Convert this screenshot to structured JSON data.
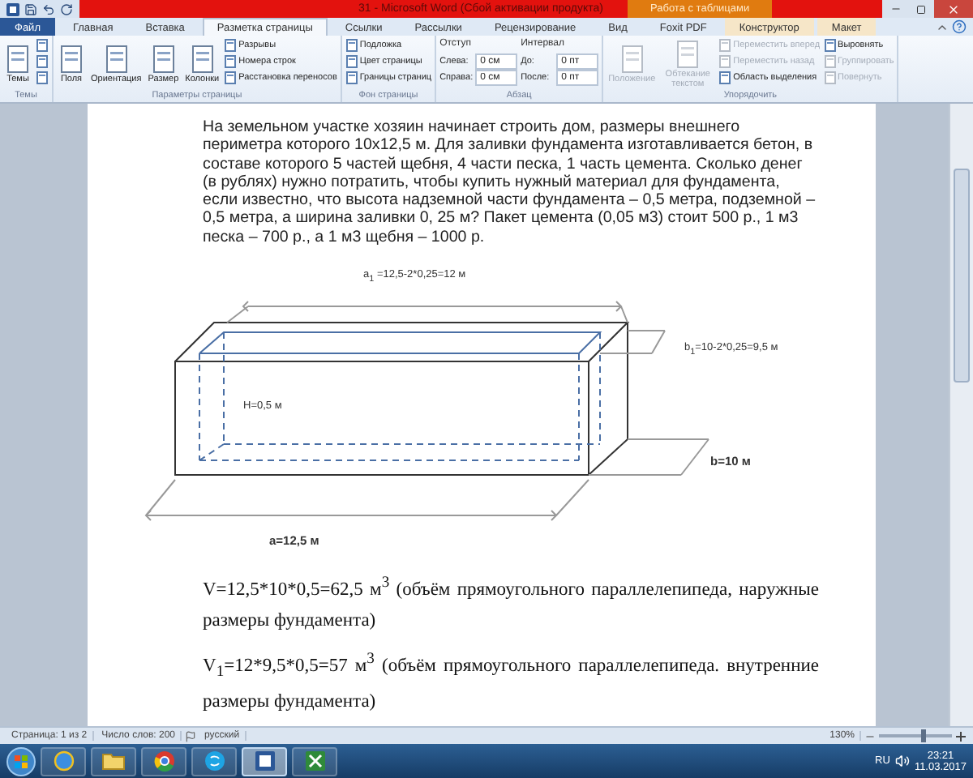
{
  "title_bar": {
    "title": "31 - Microsoft Word (Сбой активации продукта)",
    "context_tab": "Работа с таблицами"
  },
  "tabs": [
    {
      "label": "Файл",
      "kind": "file",
      "selected": false
    },
    {
      "label": "Главная",
      "kind": "normal",
      "selected": false
    },
    {
      "label": "Вставка",
      "kind": "normal",
      "selected": false
    },
    {
      "label": "Разметка страницы",
      "kind": "normal",
      "selected": true
    },
    {
      "label": "Ссылки",
      "kind": "normal",
      "selected": false
    },
    {
      "label": "Рассылки",
      "kind": "normal",
      "selected": false
    },
    {
      "label": "Рецензирование",
      "kind": "normal",
      "selected": false
    },
    {
      "label": "Вид",
      "kind": "normal",
      "selected": false
    },
    {
      "label": "Foxit PDF",
      "kind": "normal",
      "selected": false
    },
    {
      "label": "Конструктор",
      "kind": "context",
      "selected": false
    },
    {
      "label": "Макет",
      "kind": "context",
      "selected": false
    }
  ],
  "ribbon": {
    "groups": [
      {
        "label": "Темы",
        "columns": [
          [
            {
              "kind": "large",
              "label": "Темы",
              "disabled": false
            }
          ],
          [
            {
              "kind": "icon",
              "disabled": false
            },
            {
              "kind": "icon",
              "disabled": false
            },
            {
              "kind": "icon",
              "disabled": false
            }
          ]
        ]
      },
      {
        "label": "Параметры страницы",
        "columns": [
          [
            {
              "kind": "large",
              "label": "Поля",
              "disabled": false
            }
          ],
          [
            {
              "kind": "large",
              "label": "Ориентация",
              "disabled": false
            }
          ],
          [
            {
              "kind": "large",
              "label": "Размер",
              "disabled": false
            }
          ],
          [
            {
              "kind": "large",
              "label": "Колонки",
              "disabled": false
            }
          ],
          [
            {
              "kind": "small",
              "label": "Разрывы",
              "disabled": false
            },
            {
              "kind": "small",
              "label": "Номера строк",
              "disabled": false
            },
            {
              "kind": "small",
              "label": "Расстановка переносов",
              "disabled": false
            }
          ]
        ]
      },
      {
        "label": "Фон страницы",
        "columns": [
          [
            {
              "kind": "small",
              "label": "Подложка",
              "disabled": false
            },
            {
              "kind": "small",
              "label": "Цвет страницы",
              "disabled": false
            },
            {
              "kind": "small",
              "label": "Границы страниц",
              "disabled": false
            }
          ]
        ]
      },
      {
        "label": "Абзац",
        "columns": [
          [
            {
              "kind": "header",
              "label": "Отступ"
            },
            {
              "kind": "spin",
              "label": "Слева:",
              "value": "0 см"
            },
            {
              "kind": "spin",
              "label": "Справа:",
              "value": "0 см"
            }
          ],
          [
            {
              "kind": "header",
              "label": "Интервал"
            },
            {
              "kind": "spin",
              "label": "До:",
              "value": "0 пт"
            },
            {
              "kind": "spin",
              "label": "После:",
              "value": "0 пт"
            }
          ]
        ]
      },
      {
        "label": "Упорядочить",
        "columns": [
          [
            {
              "kind": "large",
              "label": "Положение",
              "disabled": true
            }
          ],
          [
            {
              "kind": "large",
              "label": "Обтекание текстом",
              "disabled": true
            }
          ],
          [
            {
              "kind": "small",
              "label": "Переместить вперед",
              "disabled": true
            },
            {
              "kind": "small",
              "label": "Переместить назад",
              "disabled": true
            },
            {
              "kind": "small",
              "label": "Область выделения",
              "disabled": false
            }
          ],
          [
            {
              "kind": "small",
              "label": "Выровнять",
              "disabled": false
            },
            {
              "kind": "small",
              "label": "Группировать",
              "disabled": true
            },
            {
              "kind": "small",
              "label": "Повернуть",
              "disabled": true
            }
          ]
        ]
      }
    ]
  },
  "document": {
    "problem": "На земельном участке хозяин начинает строить дом, размеры внешнего периметра которого 10х12,5 м. Для заливки фундамента изготавливается бетон, в составе которого 5 частей щебня, 4 части песка, 1 часть цемента. Сколько денег (в рублях) нужно потратить, чтобы купить нужный материал для фундамента, если известно, что высота надземной части фундамента – 0,5 метра, подземной – 0,5 метра, а ширина заливки 0, 25 м? Пакет цемента (0,05 м3) стоит 500 р., 1 м3 песка – 700 р., а 1 м3 щебня – 1000 р.",
    "figure_labels": {
      "a1": "a$_{1}$ =12,5-2*0,25=12 м",
      "b1": "b$_{1}$=10-2*0,25=9,5 м",
      "h": "H=0,5 м",
      "b": "b=10 м",
      "a": "a=12,5 м"
    },
    "formulas": [
      "V=12,5*10*0,5=62,5 м$^{3}$ (объём прямоугольного параллелепипеда, наружные размеры фундамента)",
      "V$_{1}$=12*9,5*0,5=57 м$^{3}$ (объём прямоугольного параллелепипеда. внутренние размеры фундамента)"
    ]
  },
  "status_bar": {
    "page": "Страница: 1 из 2",
    "words": "Число слов: 200",
    "language": "русский",
    "zoom": "130%",
    "zoom_slider": {
      "level": 0.6
    }
  },
  "taskbar": {
    "apps": [
      {
        "kind": "browser",
        "selected": false
      },
      {
        "kind": "folder",
        "selected": false
      },
      {
        "kind": "chrome",
        "selected": false
      },
      {
        "kind": "chat",
        "selected": false
      },
      {
        "kind": "word",
        "selected": true
      },
      {
        "kind": "sheet",
        "selected": false
      }
    ],
    "language": "RU",
    "time": "23:21",
    "date": "11.03.2017"
  }
}
